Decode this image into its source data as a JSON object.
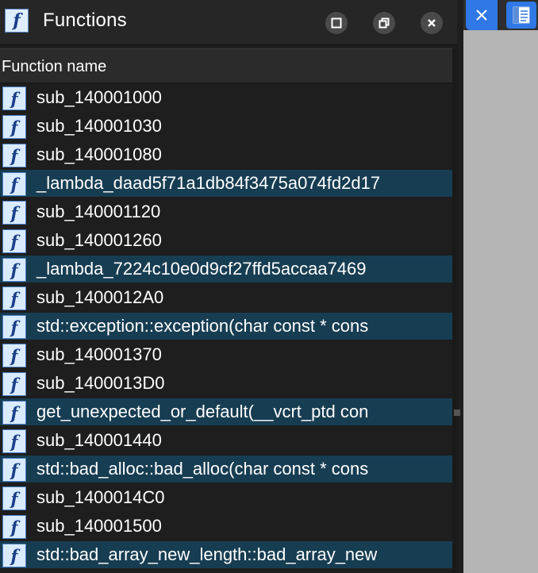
{
  "window": {
    "title": "Functions",
    "title_icon": "function-f-icon",
    "buttons": [
      "maximize-icon",
      "restore-icon",
      "close-icon"
    ]
  },
  "columns": {
    "function_name": "Function name"
  },
  "functions": [
    {
      "name": "sub_140001000",
      "selected": false
    },
    {
      "name": "sub_140001030",
      "selected": false
    },
    {
      "name": "sub_140001080",
      "selected": false
    },
    {
      "name": "_lambda_daad5f71a1db84f3475a074fd2d17",
      "selected": true
    },
    {
      "name": "sub_140001120",
      "selected": false
    },
    {
      "name": "sub_140001260",
      "selected": false
    },
    {
      "name": "_lambda_7224c10e0d9cf27ffd5accaa7469",
      "selected": true
    },
    {
      "name": "sub_1400012A0",
      "selected": false
    },
    {
      "name": "std::exception::exception(char const * cons",
      "selected": true
    },
    {
      "name": "sub_140001370",
      "selected": false
    },
    {
      "name": "sub_1400013D0",
      "selected": false
    },
    {
      "name": "get_unexpected_or_default(__vcrt_ptd con",
      "selected": true
    },
    {
      "name": "sub_140001440",
      "selected": false
    },
    {
      "name": "std::bad_alloc::bad_alloc(char const * cons",
      "selected": true
    },
    {
      "name": "sub_1400014C0",
      "selected": false
    },
    {
      "name": "sub_140001500",
      "selected": false
    },
    {
      "name": "std::bad_array_new_length::bad_array_new",
      "selected": true
    }
  ],
  "right_panel": {
    "icons": [
      "close-tab-icon",
      "document-view-icon"
    ]
  },
  "colors": {
    "background": "#1e1e1e",
    "selected_row": "#173d52",
    "tab_accent": "#2f78e6",
    "right_panel": "#b4b4b4"
  }
}
